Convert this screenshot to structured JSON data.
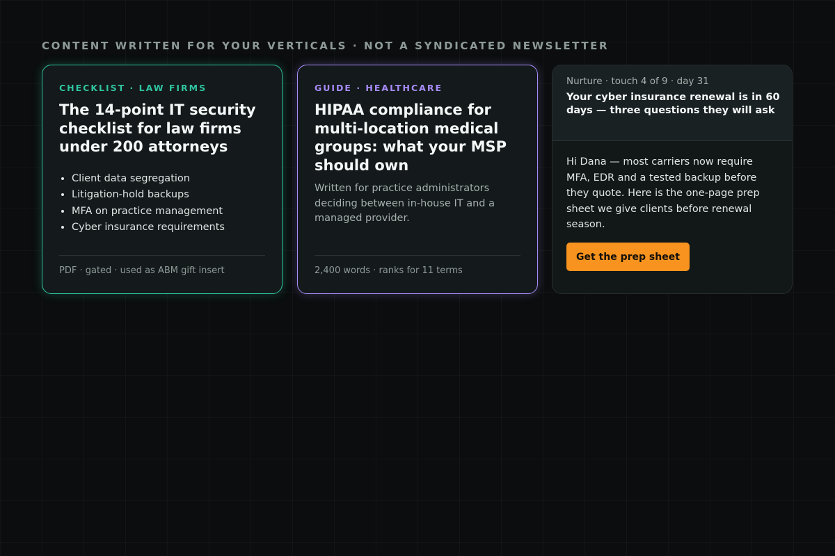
{
  "section": {
    "heading": "CONTENT WRITTEN FOR YOUR VERTICALS · NOT A SYNDICATED NEWSLETTER"
  },
  "cards": [
    {
      "tag": "CHECKLIST · LAW FIRMS",
      "accent": "#2ec4a0",
      "title": "The 14-point IT security checklist for law firms under 200 attorneys",
      "bullets": [
        "Client data segregation",
        "Litigation-hold backups",
        "MFA on practice management",
        "Cyber insurance requirements"
      ],
      "footer": "PDF · gated · used as ABM gift insert"
    },
    {
      "tag": "GUIDE · HEALTHCARE",
      "accent": "#a78bfa",
      "title": "HIPAA compliance for multi-location medical groups: what your MSP should own",
      "description": "Written for practice administrators deciding between in-house IT and a managed provider.",
      "footer": "2,400 words · ranks for 11 terms"
    }
  ],
  "email": {
    "meta": "Nurture · touch 4 of 9 · day 31",
    "subject": "Your cyber insurance renewal is in 60 days — three questions they will ask",
    "body": "Hi Dana — most carriers now require MFA, EDR and a tested backup before they quote. Here is the one-page prep sheet we give clients before renewal season.",
    "cta_label": "Get the prep sheet",
    "cta_color": "#f7931e"
  }
}
